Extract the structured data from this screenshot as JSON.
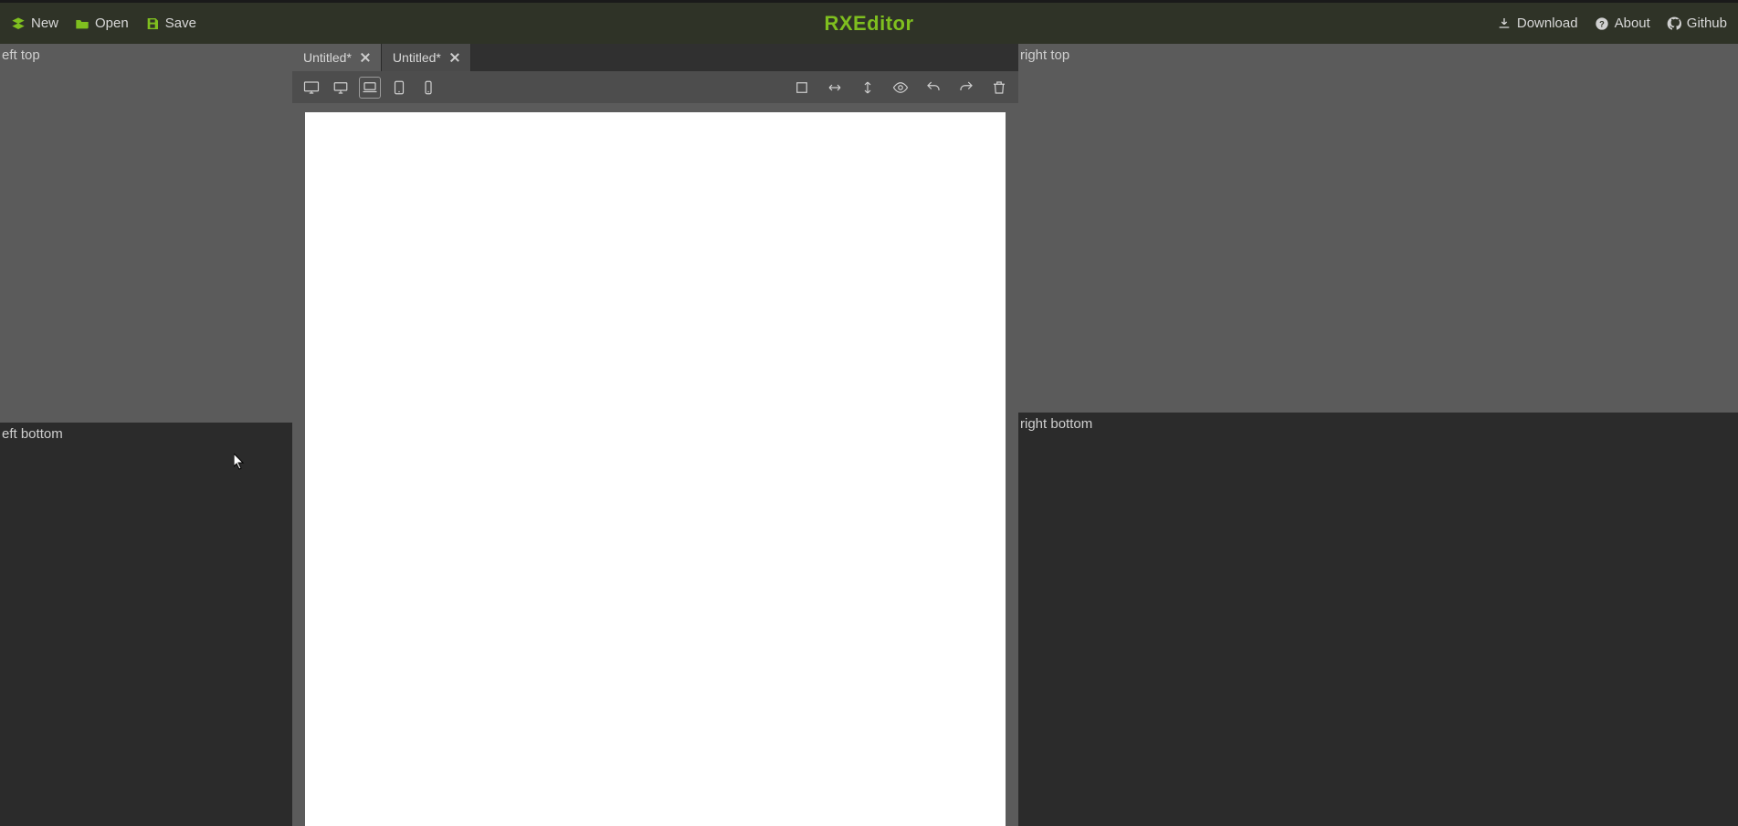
{
  "app": {
    "title": "RXEditor"
  },
  "menu": {
    "left": {
      "new": "New",
      "open": "Open",
      "save": "Save"
    },
    "right": {
      "download": "Download",
      "about": "About",
      "github": "Github"
    }
  },
  "tabs": [
    {
      "label": "Untitled*",
      "active": true
    },
    {
      "label": "Untitled*",
      "active": false
    }
  ],
  "device_toolbar": {
    "options": [
      "desktop-large",
      "desktop",
      "laptop",
      "tablet",
      "phone"
    ],
    "active": "laptop"
  },
  "action_toolbar": {
    "items": [
      "outline",
      "flip-horizontal",
      "flip-vertical",
      "preview",
      "undo",
      "redo",
      "delete"
    ]
  },
  "panels": {
    "left_top": "eft top",
    "left_bottom": "eft bottom",
    "right_top": "right top",
    "right_bottom": "right bottom"
  }
}
